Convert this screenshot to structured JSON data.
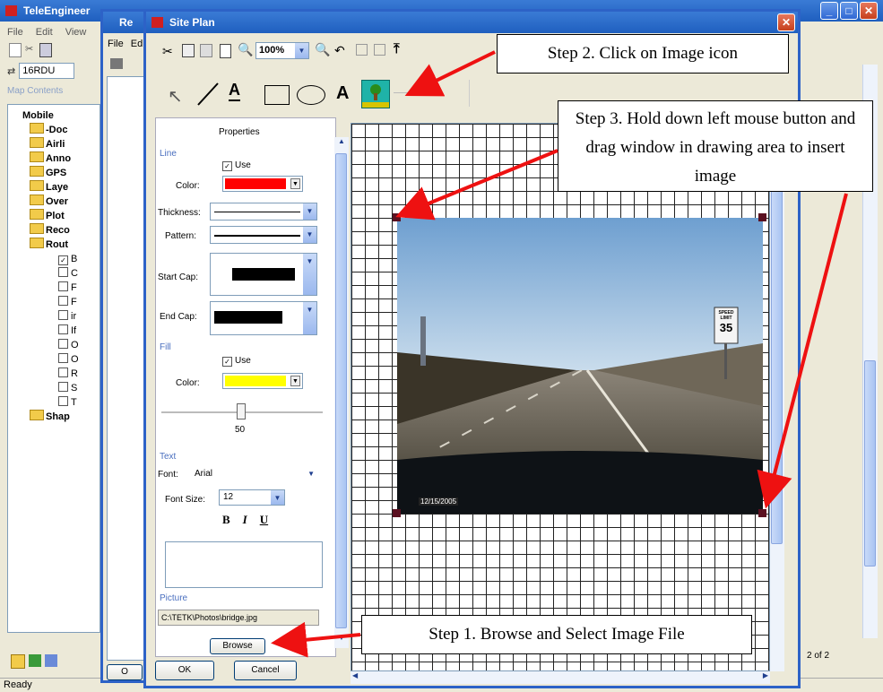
{
  "main_window": {
    "title": "TeleEngineer",
    "menu": [
      "File",
      "Edit",
      "View"
    ],
    "search_value": "16RDU",
    "panel_label": "Map Contents",
    "tree": {
      "root": "Mobile",
      "items": [
        "-Doc",
        "Airli",
        "Anno",
        "GPS",
        "Laye",
        "Over",
        "Plot",
        "Reco",
        "Rout"
      ],
      "sub_items": [
        "B",
        "C",
        "F",
        "F",
        "ir",
        "If",
        "O",
        "O",
        "R",
        "S",
        "T"
      ],
      "last": "Shap"
    },
    "status": "Ready",
    "page_indicator": "2 of 2"
  },
  "second_window": {
    "title": "Re",
    "menu": [
      "File",
      "Ed"
    ],
    "ok_fragment": "O"
  },
  "site_plan": {
    "title": "Site Plan",
    "zoom": "100%",
    "properties_title": "Properties",
    "line": {
      "section": "Line",
      "use_label": "Use",
      "color_label": "Color:",
      "color": "#ff0000",
      "thickness_label": "Thickness:",
      "pattern_label": "Pattern:",
      "start_cap_label": "Start Cap:",
      "end_cap_label": "End Cap:"
    },
    "fill": {
      "section": "Fill",
      "use_label": "Use",
      "color_label": "Color:",
      "color": "#ffff00",
      "slider_value": "50"
    },
    "text": {
      "section": "Text",
      "font_label": "Font:",
      "font_value": "Arial",
      "size_label": "Font Size:",
      "size_value": "12",
      "bold": "B",
      "italic": "I",
      "underline": "U"
    },
    "picture": {
      "section": "Picture",
      "path": "C:\\TETK\\Photos\\bridge.jpg",
      "browse_label": "Browse"
    },
    "ok_label": "OK",
    "cancel_label": "Cancel",
    "photo_stamp": "12/15/2005",
    "sign": {
      "line1": "SPEED",
      "line2": "LIMIT",
      "value": "35"
    }
  },
  "callouts": {
    "step1": "Step 1.  Browse and Select Image File",
    "step2": "Step 2.  Click on Image icon",
    "step3": "Step 3.  Hold down left mouse button and drag window in drawing area to insert image"
  },
  "colors": {
    "xp_blue": "#2d62c7",
    "arrow_red": "#ee1111"
  }
}
